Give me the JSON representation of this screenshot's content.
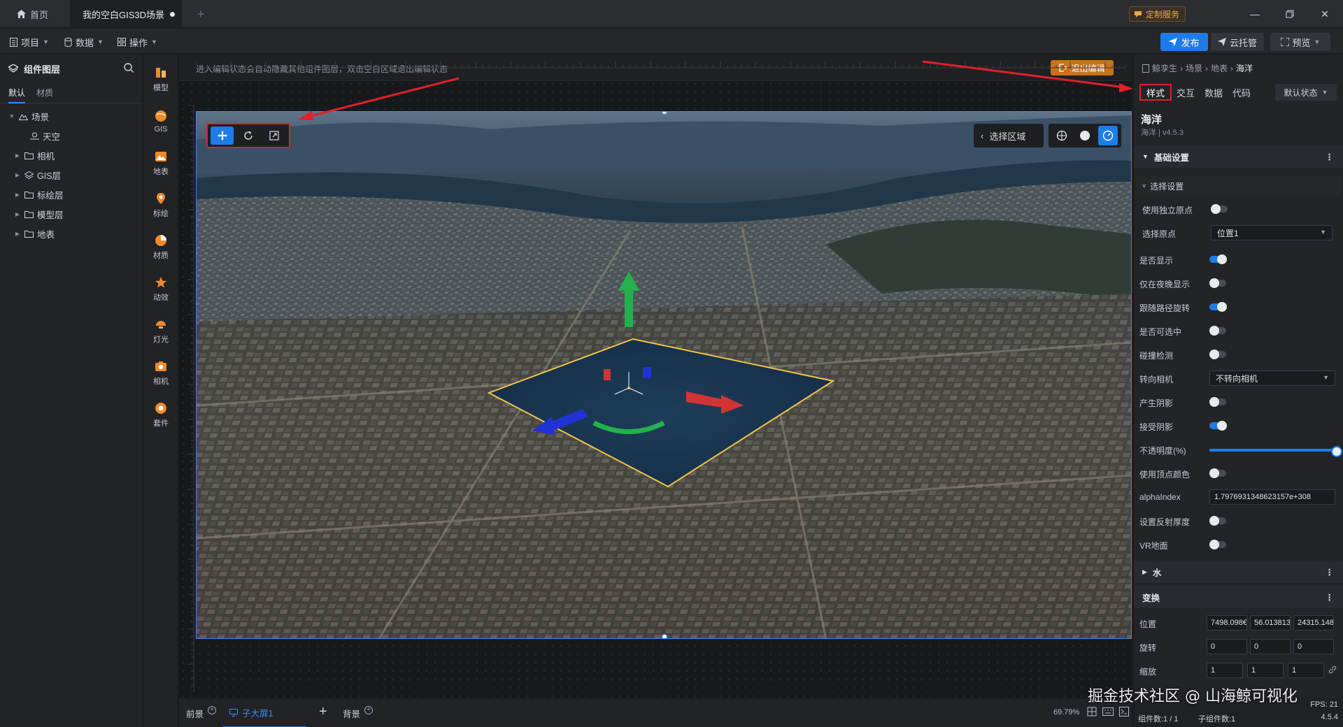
{
  "titlebar": {
    "home_tab": "首页",
    "scene_tab": "我的空白GIS3D场景",
    "custom_service": "定制服务"
  },
  "toolbar": {
    "project": "项目",
    "data": "数据",
    "operate": "操作",
    "publish": "发布",
    "cloud": "云托管",
    "preview": "预览"
  },
  "left_panel": {
    "title": "组件图层",
    "tabs": [
      "默认",
      "材质"
    ],
    "tree": [
      {
        "label": "场景",
        "expanded": true
      },
      {
        "label": "天空"
      },
      {
        "label": "相机"
      },
      {
        "label": "GIS层"
      },
      {
        "label": "标绘层"
      },
      {
        "label": "模型层"
      },
      {
        "label": "地表"
      }
    ]
  },
  "icon_rail": [
    "模型",
    "GIS",
    "地表",
    "标绘",
    "材质",
    "动效",
    "灯光",
    "相机",
    "套件"
  ],
  "canvas": {
    "hint": "进入编辑状态会自动隐藏其他组件图层，双击空白区域退出编辑状态",
    "exit_edit": "退出编辑",
    "region_label": "选择区域"
  },
  "bottom_bar": {
    "foreground": "前景",
    "screen": "子大屏1",
    "background": "背景",
    "zoom": "69.79%"
  },
  "right_panel": {
    "breadcrumb": [
      "鲸孪生",
      "场景",
      "地表",
      "海洋"
    ],
    "tabs": [
      "样式",
      "交互",
      "数据",
      "代码"
    ],
    "state": "默认状态",
    "name": "海洋",
    "version": "海洋 | v4.5.3",
    "section_basic": "基础设置",
    "sub_select": "选择设置",
    "use_independent_origin": "使用独立原点",
    "select_origin": "选择原点",
    "select_origin_value": "位置1",
    "props": {
      "visible": "是否显示",
      "night_only": "仅在夜晚显示",
      "follow_path": "跟随路径旋转",
      "selectable": "是否可选中",
      "collision": "碰撞检测",
      "face_camera": "转向相机",
      "face_camera_value": "不转向相机",
      "cast_shadow": "产生阴影",
      "receive_shadow": "接受阴影",
      "opacity": "不透明度(%)",
      "opacity_value": 100,
      "vertex_color": "使用顶点颜色",
      "alpha_index": "alphaIndex",
      "alpha_index_value": "1.7976931348623157e+308",
      "reflect_thickness": "设置反射厚度",
      "vr_ground": "VR地面"
    },
    "section_water": "水",
    "section_transform": "变换",
    "position_label": "位置",
    "position": [
      "7498.098€",
      "56.013813",
      "24315.148"
    ],
    "rotation_label": "旋转",
    "rotation": [
      "0",
      "0",
      "0"
    ],
    "scale_label": "缩放",
    "scale": [
      "1",
      "1",
      "1"
    ],
    "status_line1": "FPS: 21",
    "status_ver": "4.5.4",
    "status_components": "组件数:1 / 1",
    "status_sub": "子组件数:1"
  },
  "watermark": "掘金技术社区 @ 山海鲸可视化",
  "colors": {
    "accent": "#1e7ce8",
    "highlight_red": "#e0202a",
    "exit_orange": "#c8721d"
  }
}
